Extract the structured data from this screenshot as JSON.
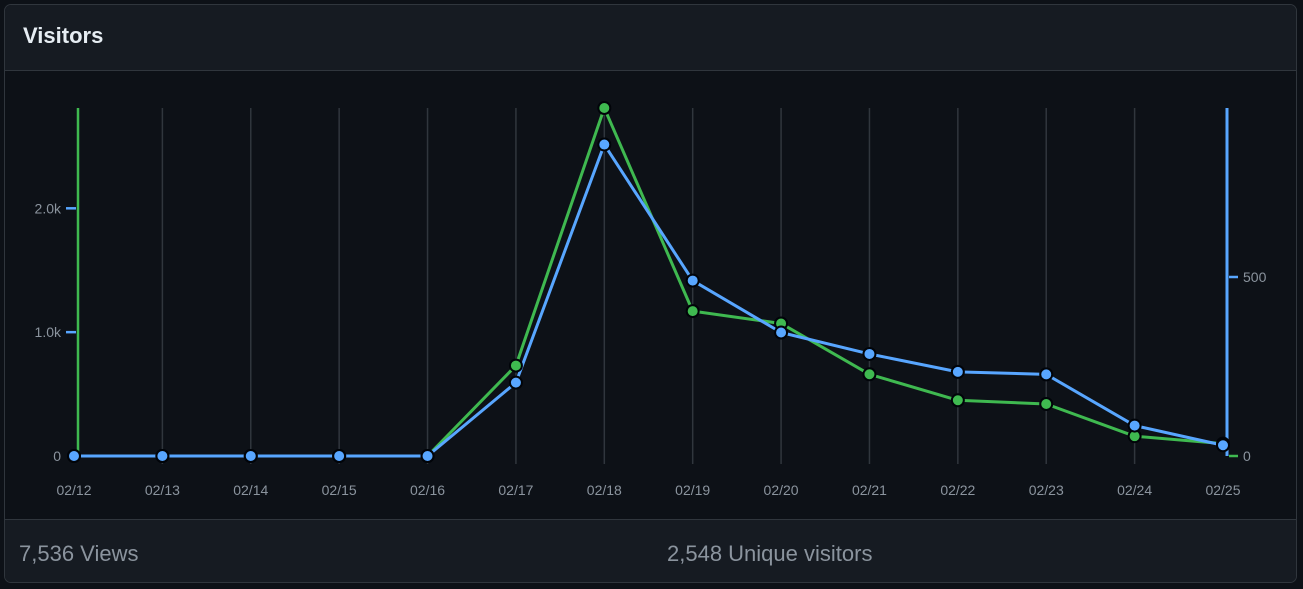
{
  "panel": {
    "title": "Visitors"
  },
  "chart_data": {
    "type": "line",
    "categories": [
      "02/12",
      "02/13",
      "02/14",
      "02/15",
      "02/16",
      "02/17",
      "02/18",
      "02/19",
      "02/20",
      "02/21",
      "02/22",
      "02/23",
      "02/24",
      "02/25"
    ],
    "series": [
      {
        "axis": "left",
        "color": "#3fb950",
        "values": [
          0,
          0,
          0,
          0,
          0,
          730,
          2810,
          1170,
          1070,
          660,
          450,
          420,
          160,
          100
        ]
      },
      {
        "axis": "right",
        "color": "#58a6ff",
        "values": [
          0,
          0,
          0,
          0,
          0,
          205,
          870,
          490,
          345,
          285,
          235,
          228,
          85,
          30
        ]
      }
    ],
    "y_left": {
      "ticks": [
        "0",
        "1.0k",
        "2.0k"
      ],
      "tick_values": [
        0,
        1000,
        2000
      ],
      "range": [
        0,
        2810
      ],
      "color": "#3fb950"
    },
    "y_right": {
      "ticks": [
        "0",
        "500"
      ],
      "tick_values": [
        0,
        500
      ],
      "range": [
        0,
        1000
      ],
      "color": "#58a6ff"
    },
    "grid": "vertical"
  },
  "summary": {
    "views": "7,536 Views",
    "unique_visitors": "2,548 Unique visitors"
  }
}
